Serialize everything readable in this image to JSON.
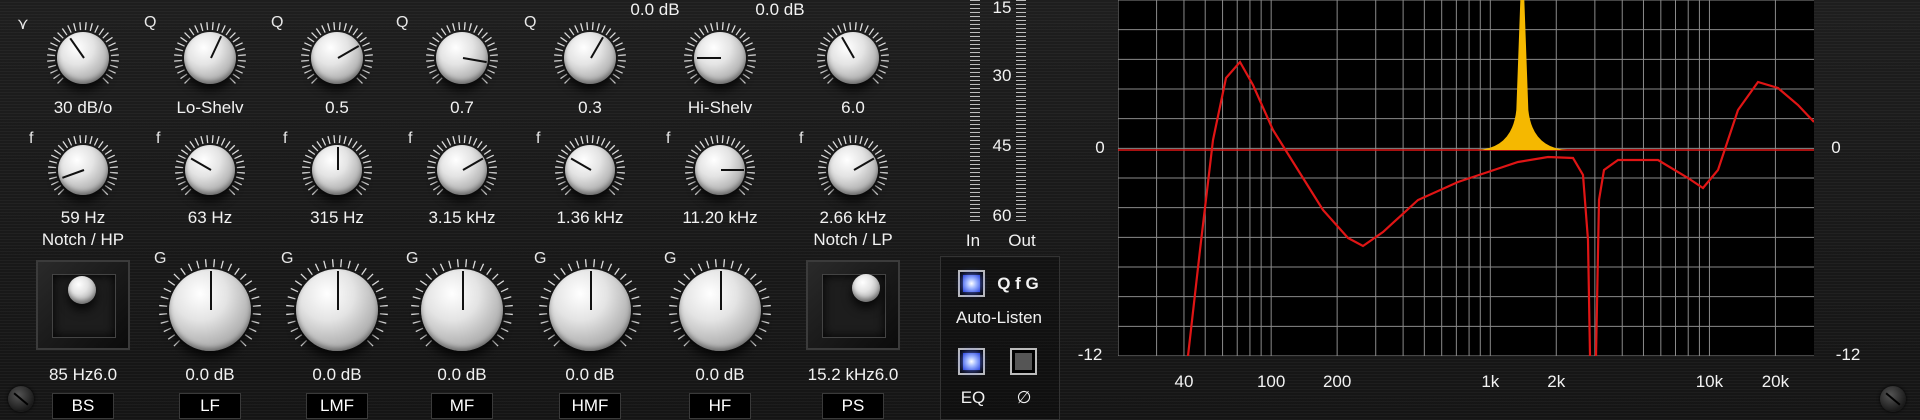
{
  "app": {
    "accent": "#2b46e0",
    "curve_color": "#e01515",
    "peak_color": "#f5b800"
  },
  "top_readouts": {
    "left": "0.0 dB",
    "right": "0.0 dB"
  },
  "row1": [
    {
      "name": "bs-slope",
      "value": "30 dB/o",
      "glyph_left": "⋎",
      "glyph_right": "⌐"
    },
    {
      "name": "lf-type",
      "value": "Lo-Shelv",
      "glyph_left": "Q"
    },
    {
      "name": "lmf-q",
      "value": "0.5",
      "glyph_left": "Q"
    },
    {
      "name": "mf-q",
      "value": "0.7",
      "glyph_left": "Q"
    },
    {
      "name": "hmf-q",
      "value": "0.3",
      "glyph_left": "Q"
    },
    {
      "name": "hf-type",
      "value": "Hi-Shelv"
    },
    {
      "name": "ps-slope",
      "value": "6.0"
    }
  ],
  "row2": [
    {
      "name": "bs-freq",
      "value": "59 Hz",
      "sub": "Notch / HP",
      "glyph_left": "f"
    },
    {
      "name": "lf-freq",
      "value": "63 Hz",
      "glyph_left": "f"
    },
    {
      "name": "lmf-freq",
      "value": "315 Hz",
      "glyph_left": "f"
    },
    {
      "name": "mf-freq",
      "value": "3.15 kHz",
      "glyph_left": "f"
    },
    {
      "name": "hmf-freq",
      "value": "1.36 kHz",
      "glyph_left": "f"
    },
    {
      "name": "hf-freq",
      "value": "11.20 kHz",
      "glyph_left": "f"
    },
    {
      "name": "ps-freq",
      "value": "2.66 kHz",
      "sub": "Notch / LP",
      "glyph_left": "f"
    }
  ],
  "row3": {
    "bs": {
      "value": "85 Hz6.0",
      "band": "BS"
    },
    "gains": [
      {
        "name": "lf-gain",
        "value": "0.0 dB",
        "band": "LF",
        "glyph_left": "G"
      },
      {
        "name": "lmf-gain",
        "value": "0.0 dB",
        "band": "LMF",
        "glyph_left": "G"
      },
      {
        "name": "mf-gain",
        "value": "0.0 dB",
        "band": "MF",
        "glyph_left": "G"
      },
      {
        "name": "hmf-gain",
        "value": "0.0 dB",
        "band": "HMF",
        "glyph_left": "G"
      },
      {
        "name": "hf-gain",
        "value": "0.0 dB",
        "band": "HF",
        "glyph_left": "G"
      }
    ],
    "ps": {
      "value": "15.2 kHz6.0",
      "band": "PS"
    }
  },
  "meter": {
    "scale": [
      "15",
      "30",
      "45",
      "60"
    ],
    "in_label": "In",
    "out_label": "Out"
  },
  "controls": {
    "qfg_label": "Q f G",
    "auto_listen_label": "Auto-Listen",
    "eq_label": "EQ",
    "phase_label": "∅"
  },
  "graph": {
    "left_labels": {
      "zero": "0",
      "min": "-12"
    },
    "right_labels": {
      "zero": "0",
      "min": "-12"
    },
    "freq_labels": [
      "40",
      "100",
      "200",
      "1k",
      "2k",
      "10k",
      "20k"
    ]
  }
}
